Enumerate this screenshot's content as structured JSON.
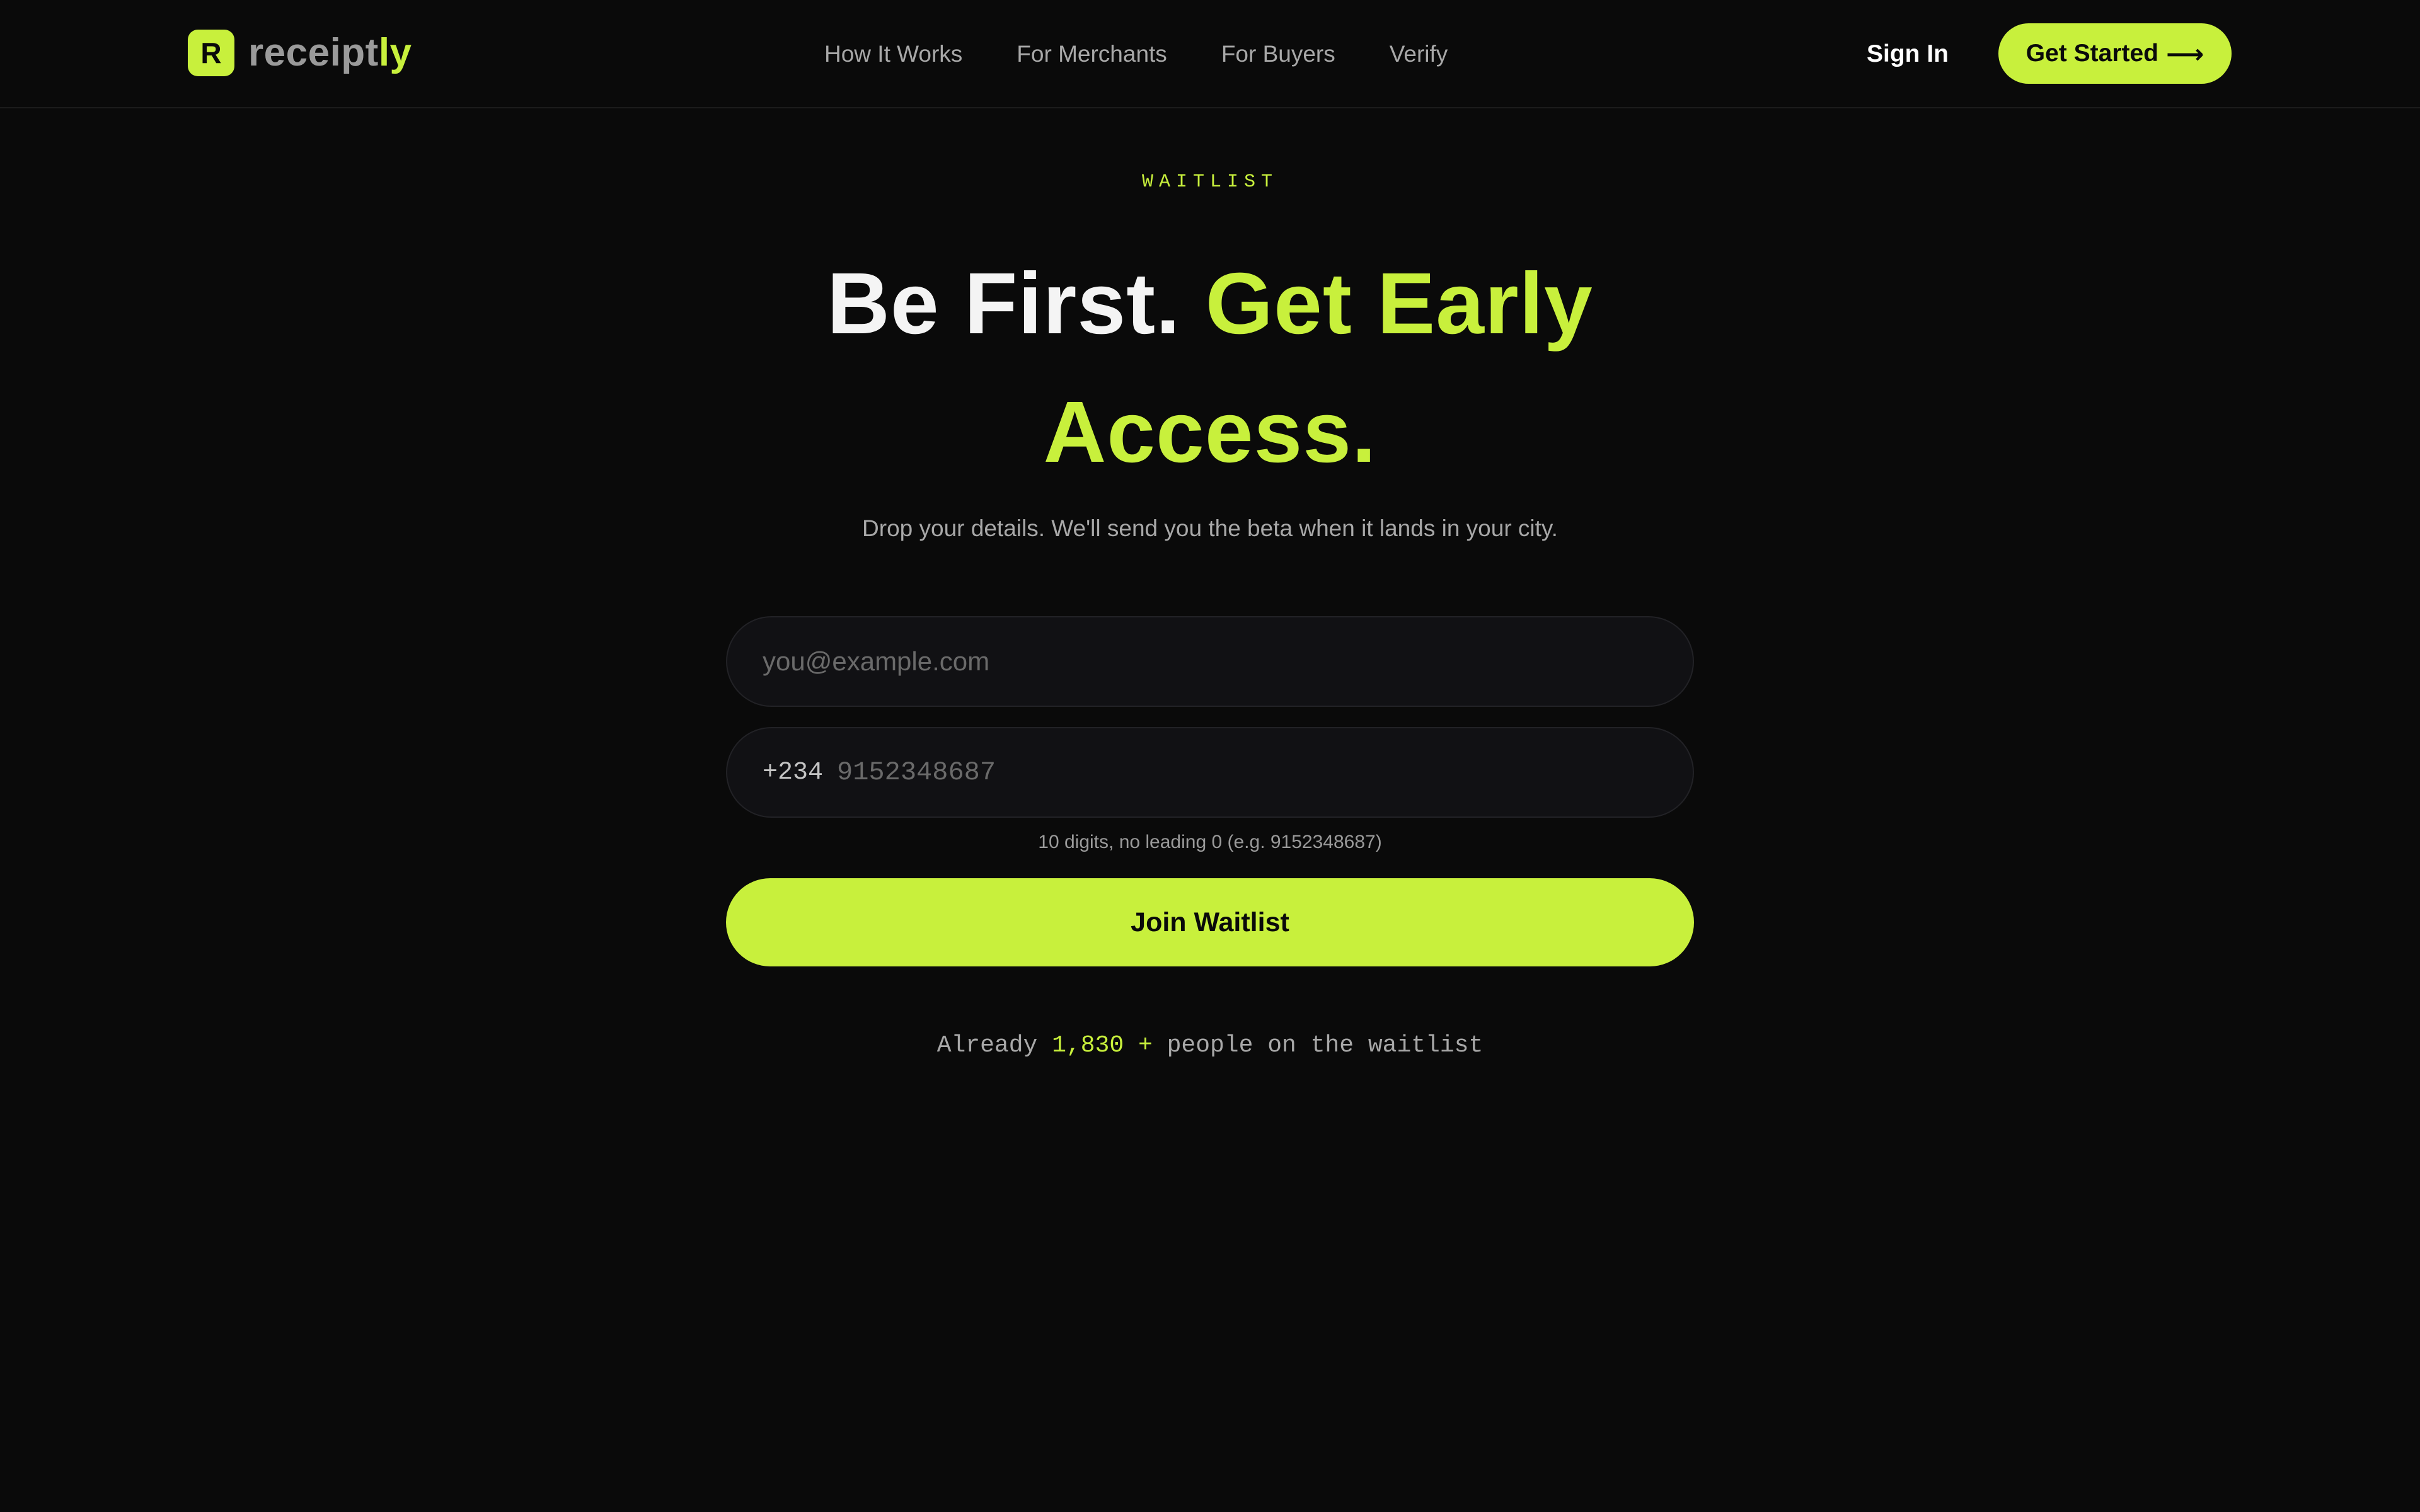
{
  "brand": {
    "logo_letter": "R",
    "wordmark_a": "receipt",
    "wordmark_b": "ly"
  },
  "nav": {
    "items": [
      {
        "label": "How It Works"
      },
      {
        "label": "For Merchants"
      },
      {
        "label": "For Buyers"
      },
      {
        "label": "Verify"
      }
    ],
    "sign_in": "Sign In",
    "get_started": "Get Started",
    "get_started_icon": "arrow-right-icon"
  },
  "hero": {
    "eyebrow": "WAITLIST",
    "headline_a": "Be First.",
    "headline_b": "Get Early Access.",
    "subtitle": "Drop your details. We'll send you the beta when it lands in your city."
  },
  "form": {
    "email": {
      "value": "",
      "placeholder": "you@example.com"
    },
    "phone": {
      "prefix": "+234",
      "value": "",
      "placeholder": "9152348687"
    },
    "hint": "10 digits, no leading 0 (e.g. 9152348687)",
    "submit_label": "Join Waitlist"
  },
  "waitlist": {
    "prefix": "Already ",
    "count": "1,830 +",
    "suffix": " people on the waitlist"
  },
  "colors": {
    "accent": "#c8f03c",
    "background": "#0a0a0a",
    "muted_text": "#a8a8a8"
  }
}
